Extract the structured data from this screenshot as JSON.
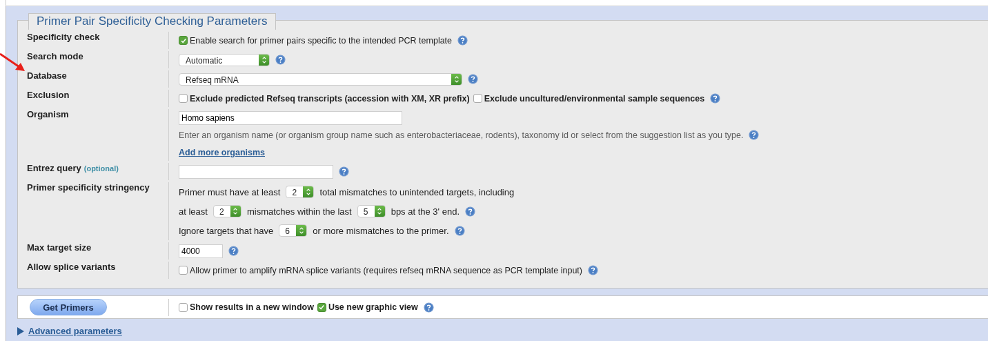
{
  "fieldset": {
    "legend": "Primer Pair Specificity Checking Parameters",
    "rows": [
      {
        "label": "Specificity check",
        "lines": [
          [
            {
              "kind": "checkbox",
              "label": "Enable search for primer pairs specific to the intended PCR template",
              "checked": true,
              "bold": false
            },
            {
              "kind": "help"
            }
          ]
        ]
      },
      {
        "label": "Search mode",
        "lines": [
          [
            {
              "kind": "select",
              "value": "Automatic"
            },
            {
              "kind": "help"
            }
          ]
        ]
      },
      {
        "label": "Database",
        "annotated": true,
        "lines": [
          [
            {
              "kind": "wide-select",
              "value": "Refseq mRNA"
            },
            {
              "kind": "help"
            }
          ]
        ]
      },
      {
        "label": "Exclusion",
        "lines": [
          [
            {
              "kind": "checkbox",
              "label": "Exclude predicted Refseq transcripts (accession with XM, XR prefix)",
              "checked": false,
              "bold": true
            },
            {
              "kind": "checkbox",
              "label": "Exclude uncultured/environmental sample sequences",
              "checked": false,
              "bold": true
            },
            {
              "kind": "help"
            }
          ]
        ]
      },
      {
        "label": "Organism",
        "lines": [
          [
            {
              "kind": "wide-input",
              "value": "Homo sapiens"
            }
          ],
          [
            {
              "kind": "hint",
              "text": "Enter an organism name (or organism group name such as enterobacteriaceae, rodents), taxonomy id or select from the suggestion list as you type."
            },
            {
              "kind": "help"
            }
          ],
          [
            {
              "kind": "link",
              "text": "Add more organisms"
            }
          ]
        ]
      },
      {
        "label": "Entrez query",
        "note": "(optional)",
        "lines": [
          [
            {
              "kind": "input"
            },
            {
              "kind": "help"
            }
          ]
        ]
      },
      {
        "label": "Primer specificity stringency",
        "lines": [
          [
            {
              "kind": "text",
              "text": "Primer must have at least"
            },
            {
              "kind": "num-select",
              "value": "2"
            },
            {
              "kind": "text",
              "text": "total mismatches to unintended targets, including"
            }
          ],
          [
            {
              "kind": "text",
              "text": "at least"
            },
            {
              "kind": "num-select",
              "value": "2"
            },
            {
              "kind": "text",
              "text": "mismatches within the last"
            },
            {
              "kind": "num-select",
              "value": "5"
            },
            {
              "kind": "text",
              "text": "bps at the 3' end."
            },
            {
              "kind": "help"
            }
          ],
          [
            {
              "kind": "text",
              "text": "Ignore targets that have"
            },
            {
              "kind": "num-select",
              "value": "6"
            },
            {
              "kind": "text",
              "text": "or more mismatches to the primer."
            },
            {
              "kind": "help"
            }
          ]
        ]
      },
      {
        "label": "Max target size",
        "lines": [
          [
            {
              "kind": "short-input",
              "value": "4000"
            },
            {
              "kind": "help"
            }
          ]
        ]
      },
      {
        "label": "Allow splice variants",
        "lines": [
          [
            {
              "kind": "checkbox",
              "label": "Allow primer to amplify mRNA splice variants (requires refseq mRNA sequence as PCR template input)",
              "checked": false,
              "bold": false
            },
            {
              "kind": "help"
            }
          ]
        ]
      }
    ]
  },
  "actions": {
    "button": "Get Primers",
    "options": [
      {
        "kind": "checkbox",
        "label": "Show results in a new window",
        "checked": false,
        "bold": true
      },
      {
        "kind": "checkbox",
        "label": "Use new graphic view",
        "checked": true,
        "bold": true
      },
      {
        "kind": "help"
      }
    ]
  },
  "advanced": {
    "label": "Advanced parameters",
    "expanded": false
  }
}
